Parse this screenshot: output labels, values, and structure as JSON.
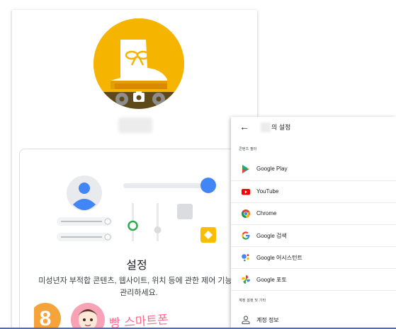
{
  "settings_card": {
    "title": "설정",
    "description_line1": "미성년자 부적합 콘텐츠, 웹사이트, 위치 등에 관한 제어 기능을",
    "description_line2": "관리하세요."
  },
  "watermark": {
    "number": "8",
    "text": "빵 스마트폰"
  },
  "panel": {
    "title": "의 설정",
    "section_content": "콘텐츠 필터",
    "items": [
      {
        "label": "Google Play",
        "icon": "google-play-icon"
      },
      {
        "label": "YouTube",
        "icon": "youtube-icon"
      },
      {
        "label": "Chrome",
        "icon": "chrome-icon"
      },
      {
        "label": "Google 검색",
        "icon": "google-g-icon"
      },
      {
        "label": "Google 어시스턴트",
        "icon": "google-assistant-icon"
      },
      {
        "label": "Google 포토",
        "icon": "google-photos-icon"
      }
    ],
    "section_account": "계정 설정 및 기타",
    "account_item": {
      "label": "계정 정보",
      "icon": "person-icon"
    }
  },
  "colors": {
    "accent_blue": "#4285f4",
    "yellow": "#f4b400",
    "green": "#34a853",
    "red": "#ea4335",
    "bottom_line": "#4a6fc9"
  }
}
